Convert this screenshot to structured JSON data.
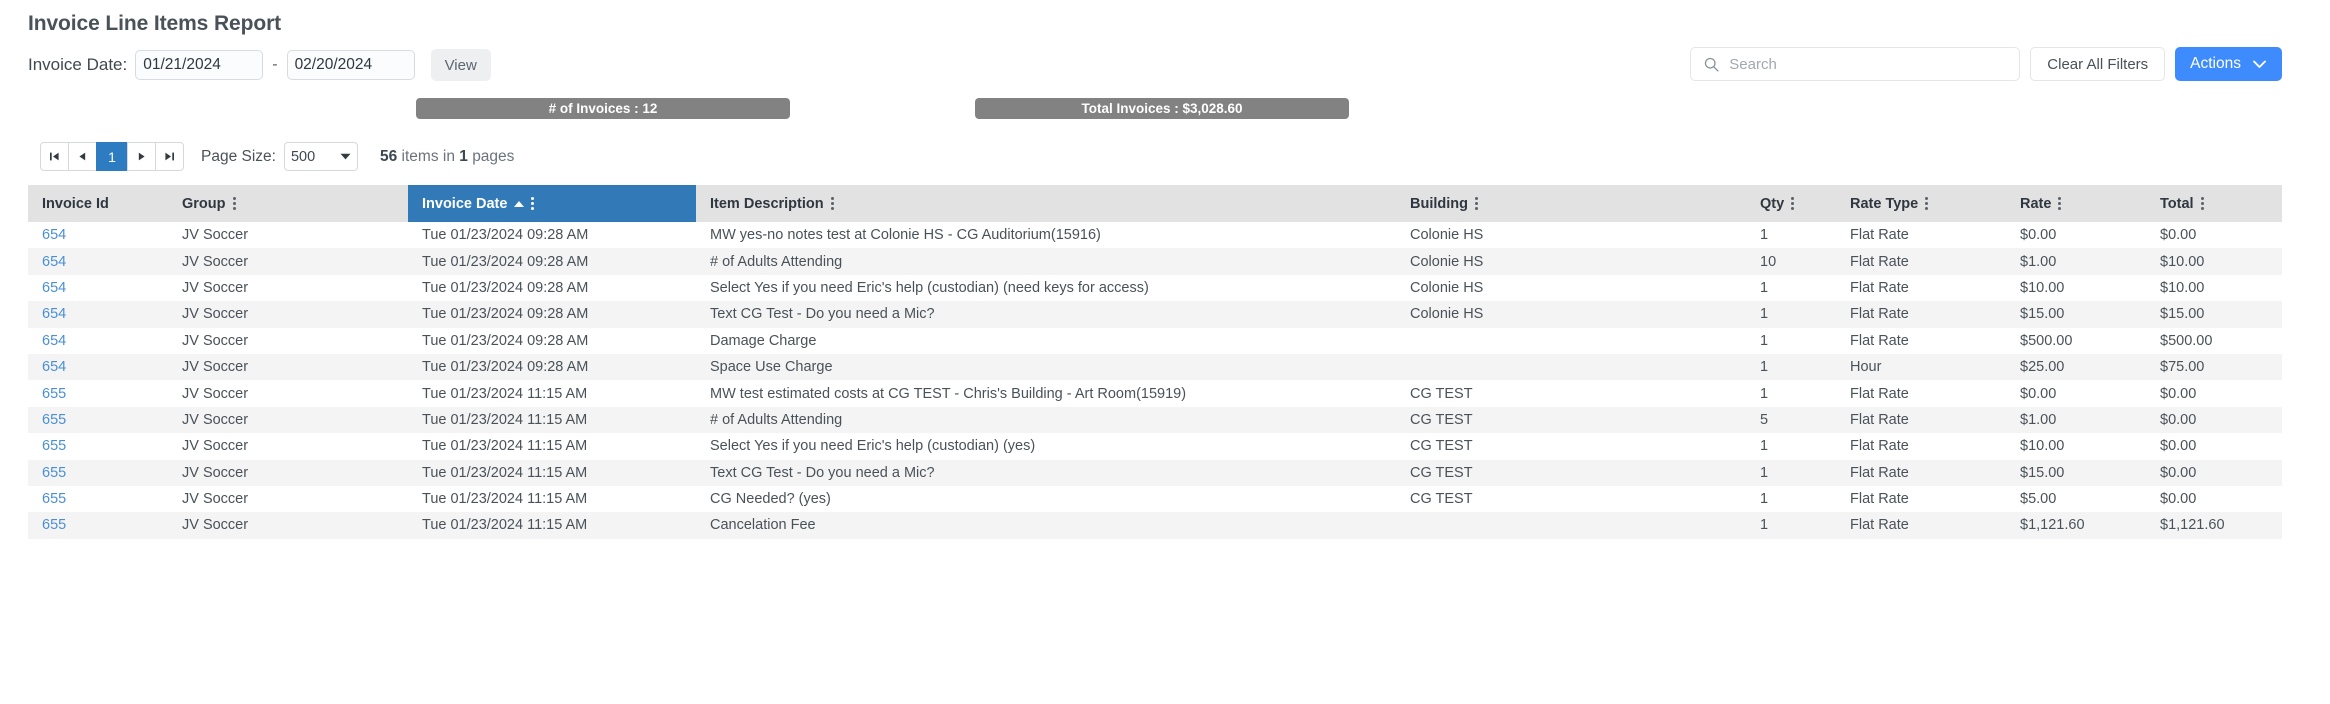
{
  "page_title": "Invoice Line Items Report",
  "filter": {
    "label": "Invoice Date:",
    "date_from": "01/21/2024",
    "separator": "-",
    "date_to": "02/20/2024",
    "view_label": "View"
  },
  "toolbar": {
    "search_placeholder": "Search",
    "search_value": "",
    "clear_filters_label": "Clear All Filters",
    "actions_label": "Actions",
    "accent_color": "#3d8bfd"
  },
  "stats": [
    {
      "text": "# of Invoices : 12"
    },
    {
      "text": "Total Invoices : $3,028.60"
    }
  ],
  "pager": {
    "first_label": "◀|",
    "prev_label": "◀",
    "current_page": "1",
    "next_label": "▶",
    "last_label": "|▶",
    "page_size_label": "Page Size:",
    "page_size_value": "500",
    "items_count": "56",
    "items_text_mid": "items in",
    "pages_count": "1",
    "items_text_end": "pages",
    "active_color": "#2d7cc1"
  },
  "table": {
    "sort_column": "Invoice Date",
    "sort_direction": "asc",
    "header_bg": "#e2e2e2",
    "sorted_header_bg": "#3279b7",
    "columns": [
      {
        "label": "Invoice Id",
        "menu": false,
        "sorted": false,
        "align": "left"
      },
      {
        "label": "Group",
        "menu": true,
        "sorted": false,
        "align": "left"
      },
      {
        "label": "Invoice Date",
        "menu": true,
        "sorted": true,
        "align": "left"
      },
      {
        "label": "Item Description",
        "menu": true,
        "sorted": false,
        "align": "left"
      },
      {
        "label": "Building",
        "menu": true,
        "sorted": false,
        "align": "left"
      },
      {
        "label": "Qty",
        "menu": true,
        "sorted": false,
        "align": "left"
      },
      {
        "label": "Rate Type",
        "menu": true,
        "sorted": false,
        "align": "left"
      },
      {
        "label": "Rate",
        "menu": true,
        "sorted": false,
        "align": "left"
      },
      {
        "label": "Total",
        "menu": true,
        "sorted": false,
        "align": "left"
      }
    ],
    "rows": [
      {
        "invoice_id": "654",
        "group": "JV Soccer",
        "invoice_date": "Tue 01/23/2024 09:28 AM",
        "item_description": "MW yes-no notes test at Colonie HS - CG Auditorium(15916)",
        "building": "Colonie HS",
        "qty": "1",
        "rate_type": "Flat Rate",
        "rate": "$0.00",
        "total": "$0.00"
      },
      {
        "invoice_id": "654",
        "group": "JV Soccer",
        "invoice_date": "Tue 01/23/2024 09:28 AM",
        "item_description": "# of Adults Attending",
        "building": "Colonie HS",
        "qty": "10",
        "rate_type": "Flat Rate",
        "rate": "$1.00",
        "total": "$10.00"
      },
      {
        "invoice_id": "654",
        "group": "JV Soccer",
        "invoice_date": "Tue 01/23/2024 09:28 AM",
        "item_description": "Select Yes if you need Eric's help (custodian) (need keys for access)",
        "building": "Colonie HS",
        "qty": "1",
        "rate_type": "Flat Rate",
        "rate": "$10.00",
        "total": "$10.00"
      },
      {
        "invoice_id": "654",
        "group": "JV Soccer",
        "invoice_date": "Tue 01/23/2024 09:28 AM",
        "item_description": "Text CG Test - Do you need a Mic?",
        "building": "Colonie HS",
        "qty": "1",
        "rate_type": "Flat Rate",
        "rate": "$15.00",
        "total": "$15.00"
      },
      {
        "invoice_id": "654",
        "group": "JV Soccer",
        "invoice_date": "Tue 01/23/2024 09:28 AM",
        "item_description": "Damage Charge",
        "building": "",
        "qty": "1",
        "rate_type": "Flat Rate",
        "rate": "$500.00",
        "total": "$500.00"
      },
      {
        "invoice_id": "654",
        "group": "JV Soccer",
        "invoice_date": "Tue 01/23/2024 09:28 AM",
        "item_description": "Space Use Charge",
        "building": "",
        "qty": "1",
        "rate_type": "Hour",
        "rate": "$25.00",
        "total": "$75.00"
      },
      {
        "invoice_id": "655",
        "group": "JV Soccer",
        "invoice_date": "Tue 01/23/2024 11:15 AM",
        "item_description": "MW test estimated costs at CG TEST - Chris's Building - Art Room(15919)",
        "building": "CG TEST",
        "qty": "1",
        "rate_type": "Flat Rate",
        "rate": "$0.00",
        "total": "$0.00"
      },
      {
        "invoice_id": "655",
        "group": "JV Soccer",
        "invoice_date": "Tue 01/23/2024 11:15 AM",
        "item_description": "# of Adults Attending",
        "building": "CG TEST",
        "qty": "5",
        "rate_type": "Flat Rate",
        "rate": "$1.00",
        "total": "$0.00"
      },
      {
        "invoice_id": "655",
        "group": "JV Soccer",
        "invoice_date": "Tue 01/23/2024 11:15 AM",
        "item_description": "Select Yes if you need Eric's help (custodian) (yes)",
        "building": "CG TEST",
        "qty": "1",
        "rate_type": "Flat Rate",
        "rate": "$10.00",
        "total": "$0.00"
      },
      {
        "invoice_id": "655",
        "group": "JV Soccer",
        "invoice_date": "Tue 01/23/2024 11:15 AM",
        "item_description": "Text CG Test - Do you need a Mic?",
        "building": "CG TEST",
        "qty": "1",
        "rate_type": "Flat Rate",
        "rate": "$15.00",
        "total": "$0.00"
      },
      {
        "invoice_id": "655",
        "group": "JV Soccer",
        "invoice_date": "Tue 01/23/2024 11:15 AM",
        "item_description": "CG Needed? (yes)",
        "building": "CG TEST",
        "qty": "1",
        "rate_type": "Flat Rate",
        "rate": "$5.00",
        "total": "$0.00"
      },
      {
        "invoice_id": "655",
        "group": "JV Soccer",
        "invoice_date": "Tue 01/23/2024 11:15 AM",
        "item_description": "Cancelation Fee",
        "building": "",
        "qty": "1",
        "rate_type": "Flat Rate",
        "rate": "$1,121.60",
        "total": "$1,121.60"
      }
    ]
  }
}
